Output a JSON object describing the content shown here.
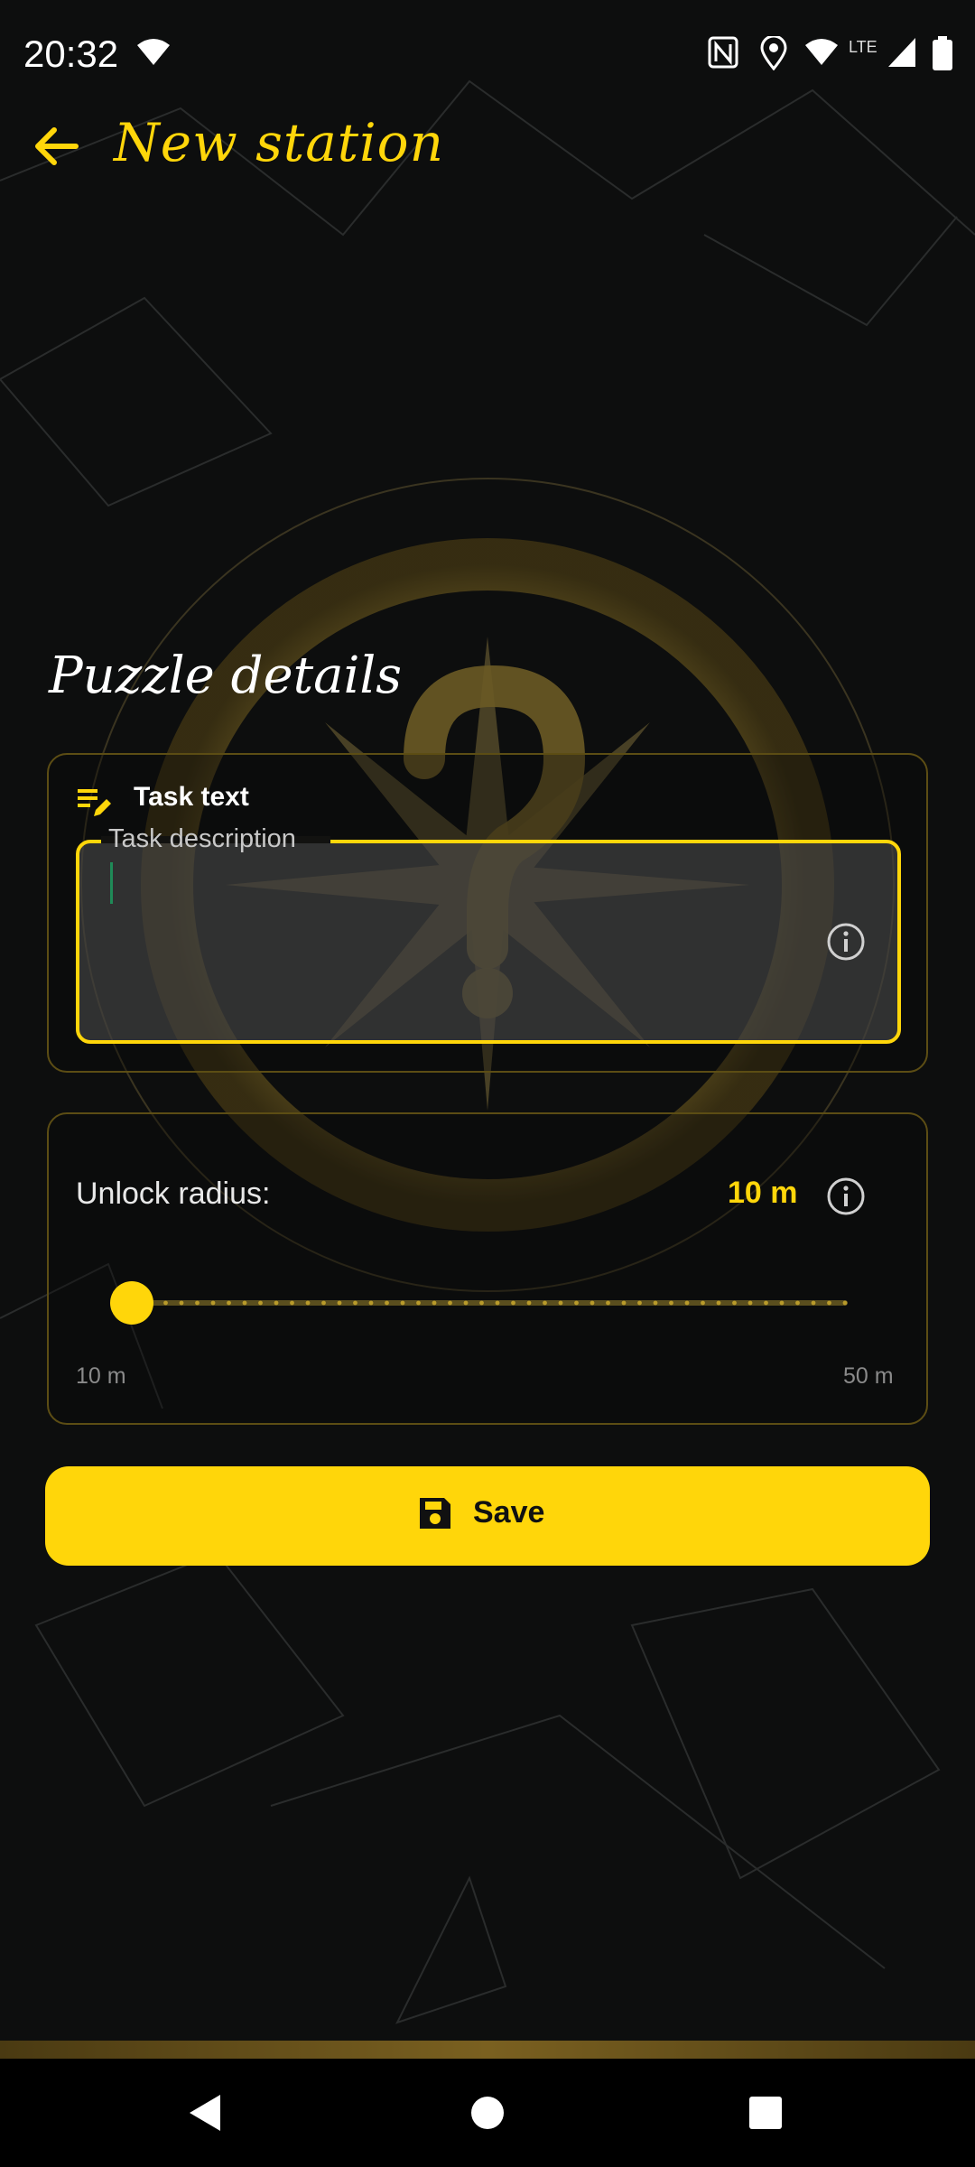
{
  "status_bar": {
    "time": "20:32",
    "icons": [
      "wifi-icon",
      "nfc-icon",
      "location-icon",
      "wifi-signal-icon",
      "lte-icon",
      "cell-signal-icon",
      "battery-icon"
    ],
    "network_label": "LTE"
  },
  "app_bar": {
    "title": "New station",
    "back_icon": "arrow-left-icon"
  },
  "puzzle": {
    "section_title": "Puzzle details",
    "task_card": {
      "header_icon": "edit-note-icon",
      "header_label": "Task text",
      "field_label": "Task description",
      "field_value": "",
      "info_icon": "info-icon"
    },
    "radius_card": {
      "label": "Unlock radius:",
      "value": "10 m",
      "info_icon": "info-icon",
      "slider_value_fraction": 0,
      "min_label": "10 m",
      "max_label": "50 m"
    }
  },
  "save_button": {
    "label": "Save",
    "icon": "floppy-disk-icon"
  },
  "nav_bar": {
    "buttons": [
      "back-triangle-icon",
      "home-circle-icon",
      "recents-square-icon"
    ]
  },
  "colors": {
    "accent": "#ffd60a",
    "background": "#0d0e0e",
    "card_border": "#5c4d14"
  }
}
